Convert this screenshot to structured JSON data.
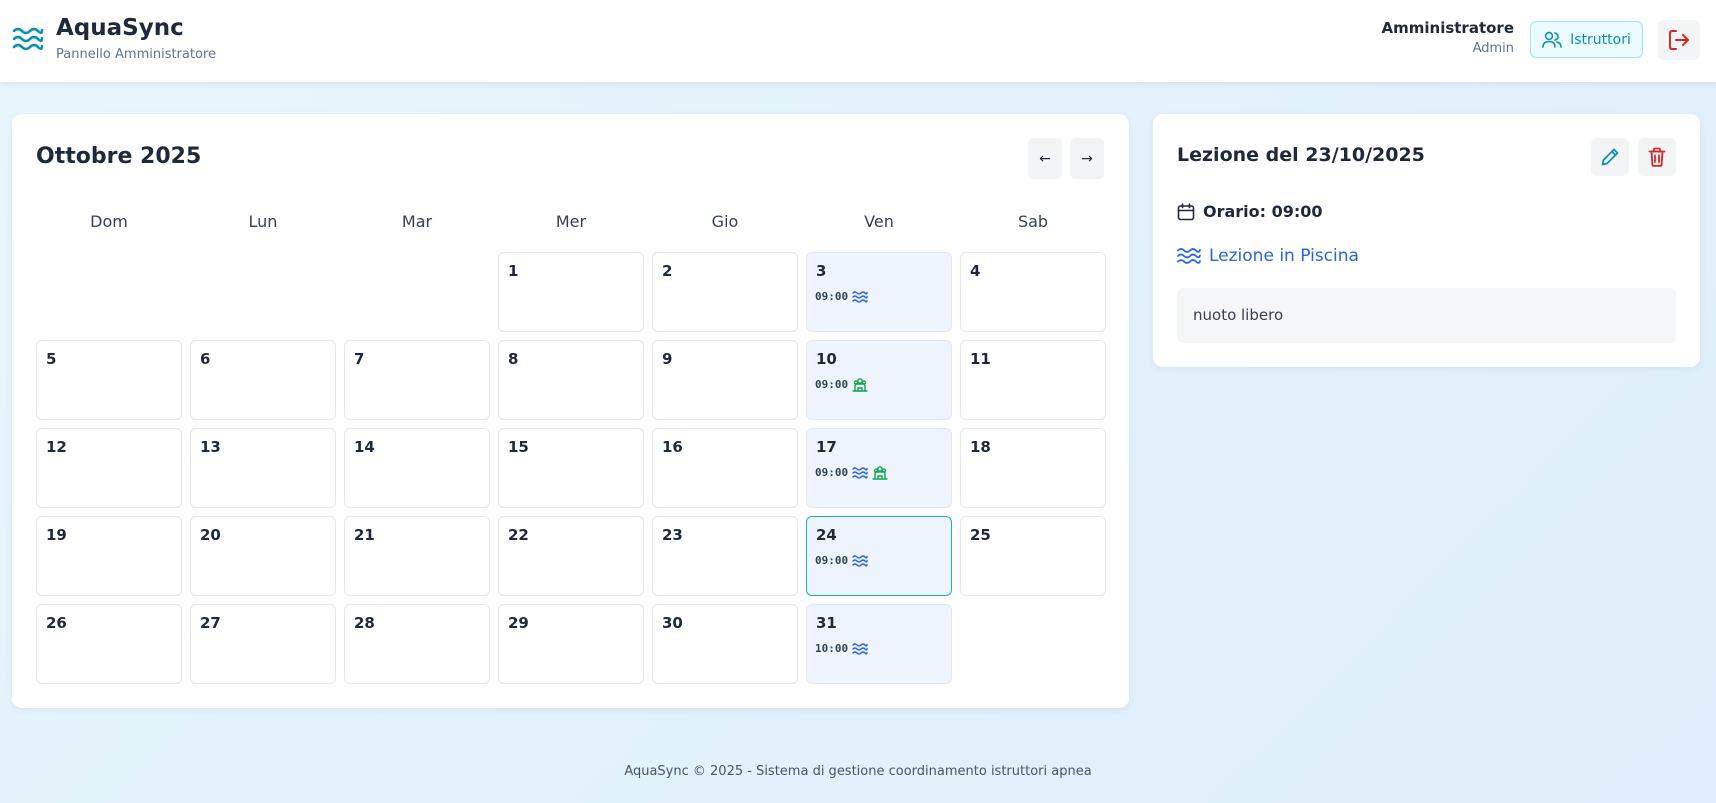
{
  "header": {
    "app_title": "AquaSync",
    "app_subtitle": "Pannello Amministratore",
    "user_name": "Amministratore",
    "user_role": "Admin",
    "instructors_label": "Istruttori",
    "logo_icon": "waves-icon",
    "instructors_icon": "users-icon",
    "logout_icon": "logout-icon"
  },
  "calendar": {
    "month_title": "Ottobre 2025",
    "prev_label": "←",
    "next_label": "→",
    "weekdays": [
      "Dom",
      "Lun",
      "Mar",
      "Mer",
      "Gio",
      "Ven",
      "Sab"
    ],
    "first_weekday_index": 3,
    "days_in_month": 31,
    "selected_day": 24,
    "events": {
      "3": {
        "time": "09:00",
        "icons": [
          "waves"
        ]
      },
      "10": {
        "time": "09:00",
        "icons": [
          "group"
        ]
      },
      "17": {
        "time": "09:00",
        "icons": [
          "waves",
          "group"
        ]
      },
      "24": {
        "time": "09:00",
        "icons": [
          "waves"
        ]
      },
      "31": {
        "time": "10:00",
        "icons": [
          "waves"
        ]
      }
    }
  },
  "detail": {
    "title": "Lezione del 23/10/2025",
    "time_label": "Orario: 09:00",
    "type_label": "Lezione in Piscina",
    "notes": "nuoto libero",
    "edit_icon": "pencil-icon",
    "delete_icon": "trash-icon",
    "calendar_icon": "calendar-icon",
    "type_icon": "waves-icon"
  },
  "footer": {
    "text": "AquaSync © 2025 - Sistema di gestione coordinamento istruttori apnea"
  },
  "colors": {
    "accent": "#0891b2",
    "link_blue": "#2563eb",
    "group_green": "#16a34a",
    "danger": "#dc2626",
    "selected_border": "#14b8a6",
    "event_bg": "#eef4fe"
  }
}
